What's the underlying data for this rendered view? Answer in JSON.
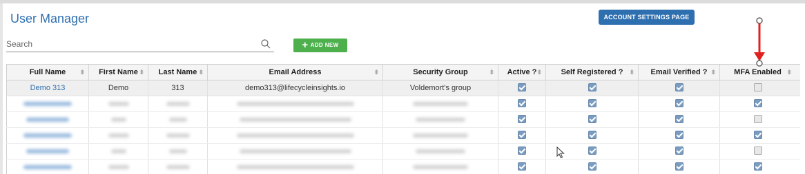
{
  "header": {
    "title": "User Manager",
    "account_settings_label": "ACCOUNT SETTINGS PAGE"
  },
  "toolbar": {
    "search_placeholder": "Search",
    "add_new_label": "ADD NEW"
  },
  "table": {
    "columns": [
      "Full Name",
      "First Name",
      "Last Name",
      "Email Address",
      "Security Group",
      "Active ?",
      "Self Registered ?",
      "Email Verified ?",
      "MFA Enabled"
    ],
    "first_row": {
      "full_name": "Demo 313",
      "first_name": "Demo",
      "last_name": "313",
      "email": "demo313@lifecycleinsights.io",
      "security_group": "Voldemort's group",
      "active": true,
      "self_registered": true,
      "email_verified": true,
      "mfa_enabled": false
    },
    "blurred_rows": [
      {
        "active": true,
        "self_registered": true,
        "email_verified": true,
        "mfa_enabled": true
      },
      {
        "active": true,
        "self_registered": true,
        "email_verified": true,
        "mfa_enabled": false
      },
      {
        "active": true,
        "self_registered": true,
        "email_verified": true,
        "mfa_enabled": true
      },
      {
        "active": true,
        "self_registered": true,
        "email_verified": true,
        "mfa_enabled": false
      },
      {
        "active": true,
        "self_registered": true,
        "email_verified": true,
        "mfa_enabled": true
      }
    ]
  },
  "colors": {
    "title": "#2e6fb0",
    "account_button": "#2e6fb0",
    "add_button": "#4db04d",
    "annotation_arrow": "#e02020"
  },
  "icons": {
    "search": "magnifier-icon",
    "sort": "sort-arrows-icon",
    "plus": "plus-icon",
    "cursor": "mouse-pointer-icon",
    "annotation": "red-arrow-icon"
  }
}
